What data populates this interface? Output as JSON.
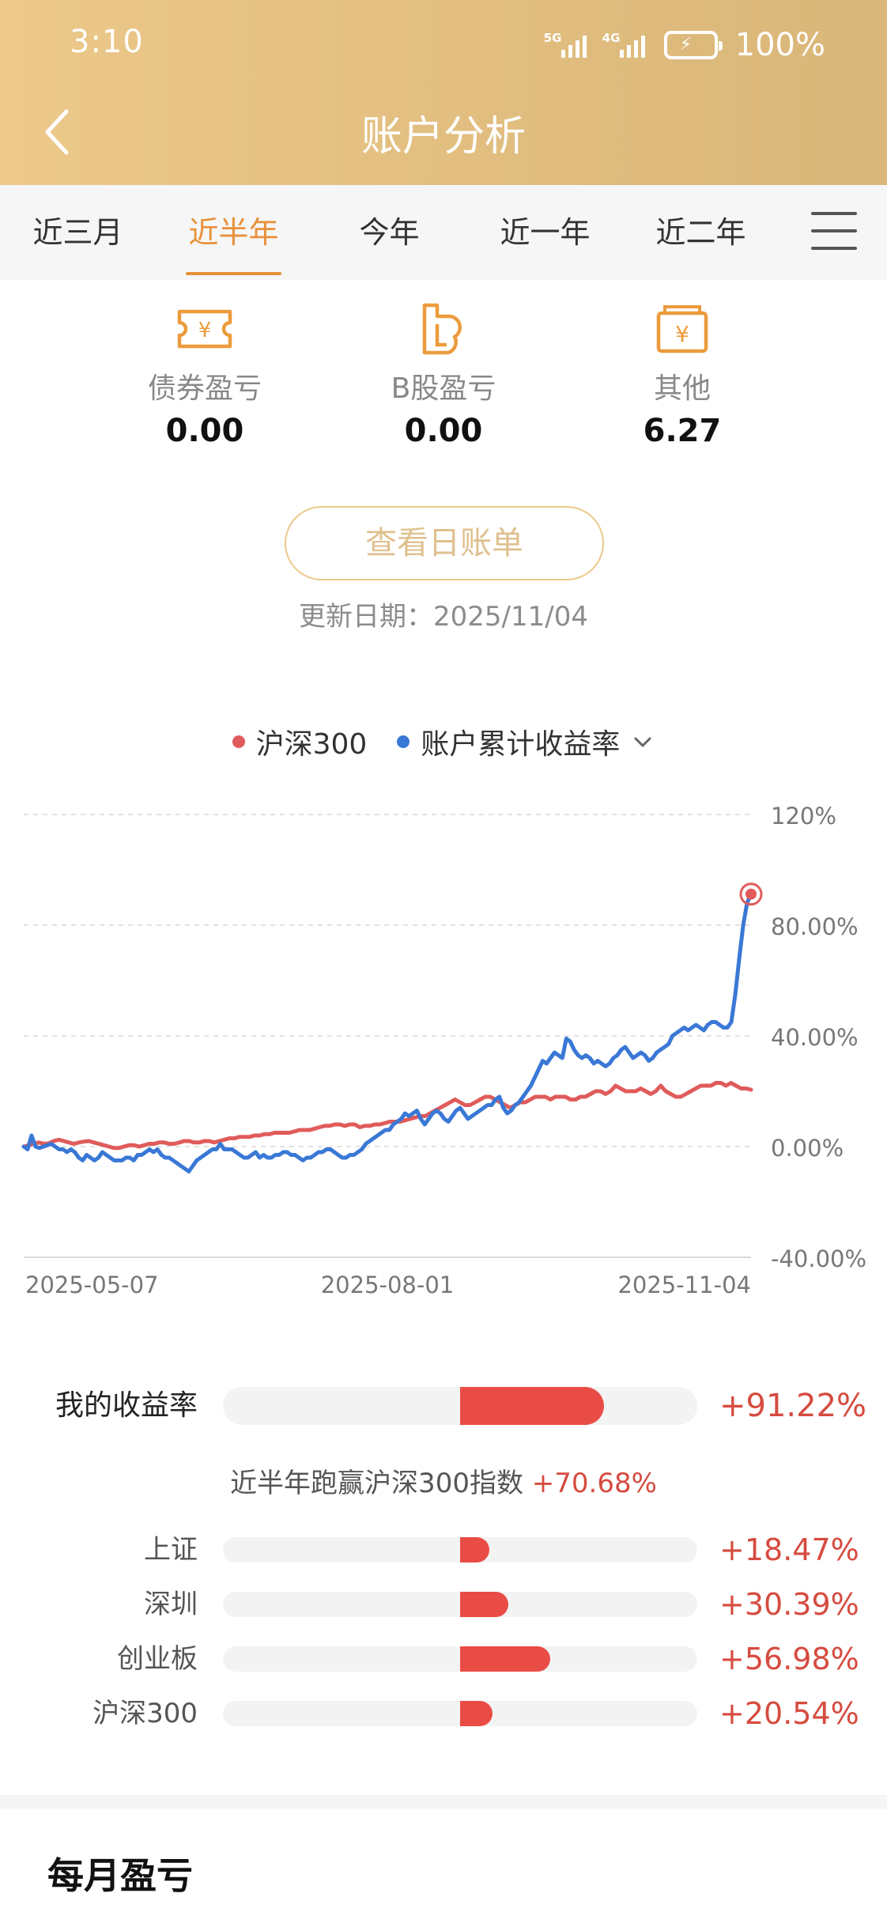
{
  "status_bar": {
    "time": "3:10",
    "net1": "5G",
    "net2": "4G",
    "battery": "100%"
  },
  "header": {
    "title": "账户分析"
  },
  "tabs": [
    {
      "label": "近三月",
      "active": false
    },
    {
      "label": "近半年",
      "active": true
    },
    {
      "label": "今年",
      "active": false
    },
    {
      "label": "近一年",
      "active": false
    },
    {
      "label": "近二年",
      "active": false
    }
  ],
  "summary": [
    {
      "icon": "ticket-yen-icon",
      "label": "债券盈亏",
      "value": "0.00"
    },
    {
      "icon": "b-share-icon",
      "label": "B股盈亏",
      "value": "0.00"
    },
    {
      "icon": "wallet-yen-icon",
      "label": "其他",
      "value": "6.27"
    }
  ],
  "bill_button": "查看日账单",
  "update_date": "更新日期：2025/11/04",
  "legend": [
    {
      "name": "沪深300",
      "color": "#e05b5b"
    },
    {
      "name": "账户累计收益率",
      "color": "#3a78d6"
    }
  ],
  "chart_data": {
    "type": "line",
    "x_ticks": [
      "2025-05-07",
      "2025-08-01",
      "2025-11-04"
    ],
    "y_ticks": [
      "120%",
      "80.00%",
      "40.00%",
      "0.00%",
      "-40.00%"
    ],
    "ylim": [
      -40,
      120
    ],
    "grid": true,
    "legend_position": "top",
    "series": [
      {
        "name": "沪深300",
        "color": "#e05b5b",
        "values": [
          0,
          0.5,
          1,
          1.5,
          1,
          1.2,
          2,
          2.5,
          2,
          1.5,
          1,
          1.5,
          1.8,
          2,
          1.5,
          1,
          0.5,
          0,
          -0.5,
          -0.5,
          0,
          0.5,
          0.5,
          0,
          0.5,
          1,
          1,
          1.5,
          1.5,
          1,
          1,
          1.5,
          2,
          2,
          1.5,
          1.5,
          2,
          2,
          1.5,
          2,
          2.5,
          3,
          3,
          3.5,
          3.5,
          3.5,
          4,
          4,
          4.5,
          4.5,
          5,
          5,
          5,
          5,
          5.5,
          6,
          6,
          6,
          6.5,
          7,
          7.5,
          7.5,
          8,
          8,
          7.5,
          8,
          8,
          7,
          7.5,
          7.5,
          8,
          8,
          8.5,
          9,
          9,
          9,
          9.5,
          10,
          10.5,
          11,
          11,
          12,
          13,
          14,
          15,
          16,
          17,
          16,
          15,
          15,
          16,
          17,
          18,
          18,
          17,
          16,
          15,
          14,
          15,
          16,
          16,
          17,
          18,
          18,
          18,
          17,
          18,
          18,
          18,
          17,
          17,
          18,
          18,
          19,
          20,
          20,
          19,
          20,
          22,
          21,
          20,
          20,
          20,
          21,
          20,
          19,
          20,
          22,
          20,
          19,
          18,
          18,
          19,
          20,
          21,
          22,
          22,
          22,
          23,
          23,
          22,
          23,
          22,
          21,
          21,
          20.54
        ]
      },
      {
        "name": "账户累计收益率",
        "color": "#3a78d6",
        "values": [
          0,
          -1,
          4,
          0,
          -0.5,
          0,
          0.5,
          1,
          0,
          -1,
          -1,
          -2,
          -1,
          -2,
          -4,
          -5,
          -3,
          -4,
          -5,
          -4,
          -2,
          -3,
          -4,
          -5,
          -5,
          -5,
          -4,
          -4,
          -5,
          -3,
          -3,
          -2,
          -1,
          -2,
          -1,
          -3,
          -4,
          -4,
          -5,
          -6,
          -7,
          -8,
          -9,
          -7,
          -5,
          -4,
          -3,
          -2,
          -1,
          -1,
          1,
          -1,
          -1,
          -1,
          -2,
          -3,
          -4,
          -4,
          -3,
          -2,
          -4,
          -3,
          -4,
          -4,
          -3,
          -3,
          -2,
          -2,
          -3,
          -3,
          -4,
          -5,
          -4,
          -4,
          -3,
          -2,
          -2,
          -1,
          -1,
          -2,
          -3,
          -4,
          -4,
          -3,
          -3,
          -2,
          -1,
          1,
          2,
          3,
          4,
          5,
          6,
          6,
          8,
          9,
          10,
          12,
          11,
          12,
          13,
          10,
          8,
          10,
          12,
          13,
          12,
          10,
          9,
          11,
          13,
          14,
          12,
          10,
          11,
          12,
          13,
          14,
          15,
          15,
          17,
          18,
          14,
          12,
          13,
          15,
          16,
          18,
          20,
          22,
          25,
          28,
          31,
          30,
          32,
          34,
          33,
          32,
          39,
          38,
          35,
          33,
          32,
          33,
          32,
          30,
          31,
          30,
          29,
          30,
          32,
          33,
          35,
          36,
          34,
          32,
          33,
          34,
          33,
          31,
          32,
          34,
          35,
          36,
          37,
          40,
          41,
          42,
          43,
          42,
          43,
          44,
          43,
          42,
          44,
          45,
          45,
          44,
          43,
          43,
          45,
          55,
          68,
          80,
          88,
          91.22
        ]
      }
    ]
  },
  "returns": {
    "mine": {
      "label": "我的收益率",
      "value": "+91.22%",
      "pct": 91.22
    },
    "beat_text": "近半年跑赢沪深300指数",
    "beat_value": "+70.68%",
    "indices": [
      {
        "label": "上证",
        "value": "+18.47%",
        "pct": 18.47
      },
      {
        "label": "深圳",
        "value": "+30.39%",
        "pct": 30.39
      },
      {
        "label": "创业板",
        "value": "+56.98%",
        "pct": 56.98
      },
      {
        "label": "沪深300",
        "value": "+20.54%",
        "pct": 20.54
      }
    ]
  },
  "monthly_title": "每月盈亏"
}
